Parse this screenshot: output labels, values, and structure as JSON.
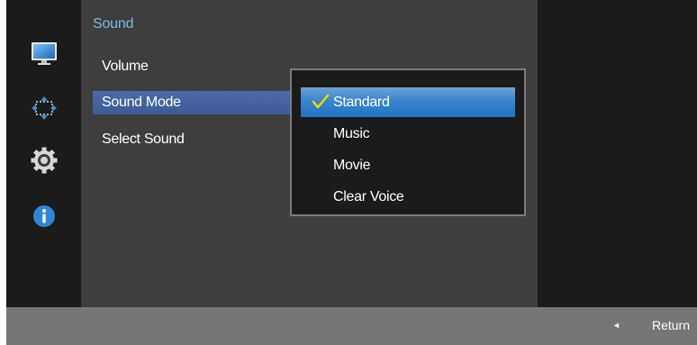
{
  "panel": {
    "title": "Sound",
    "items": [
      {
        "label": "Volume"
      },
      {
        "label": "Sound Mode"
      },
      {
        "label": "Select Sound"
      }
    ],
    "selected_index": 1
  },
  "submenu": {
    "options": [
      {
        "label": "Standard"
      },
      {
        "label": "Music"
      },
      {
        "label": "Movie"
      },
      {
        "label": "Clear Voice"
      }
    ],
    "selected_index": 0
  },
  "sidebar_icons": [
    "picture-icon",
    "onscreen-display-icon",
    "system-settings-icon",
    "information-icon"
  ],
  "footer": {
    "return_label": "Return"
  },
  "colors": {
    "accent_title": "#7dbbe9",
    "selected_item": "#4c6ba8",
    "selected_option": "#1f74c2",
    "checkmark": "#f5d800"
  }
}
